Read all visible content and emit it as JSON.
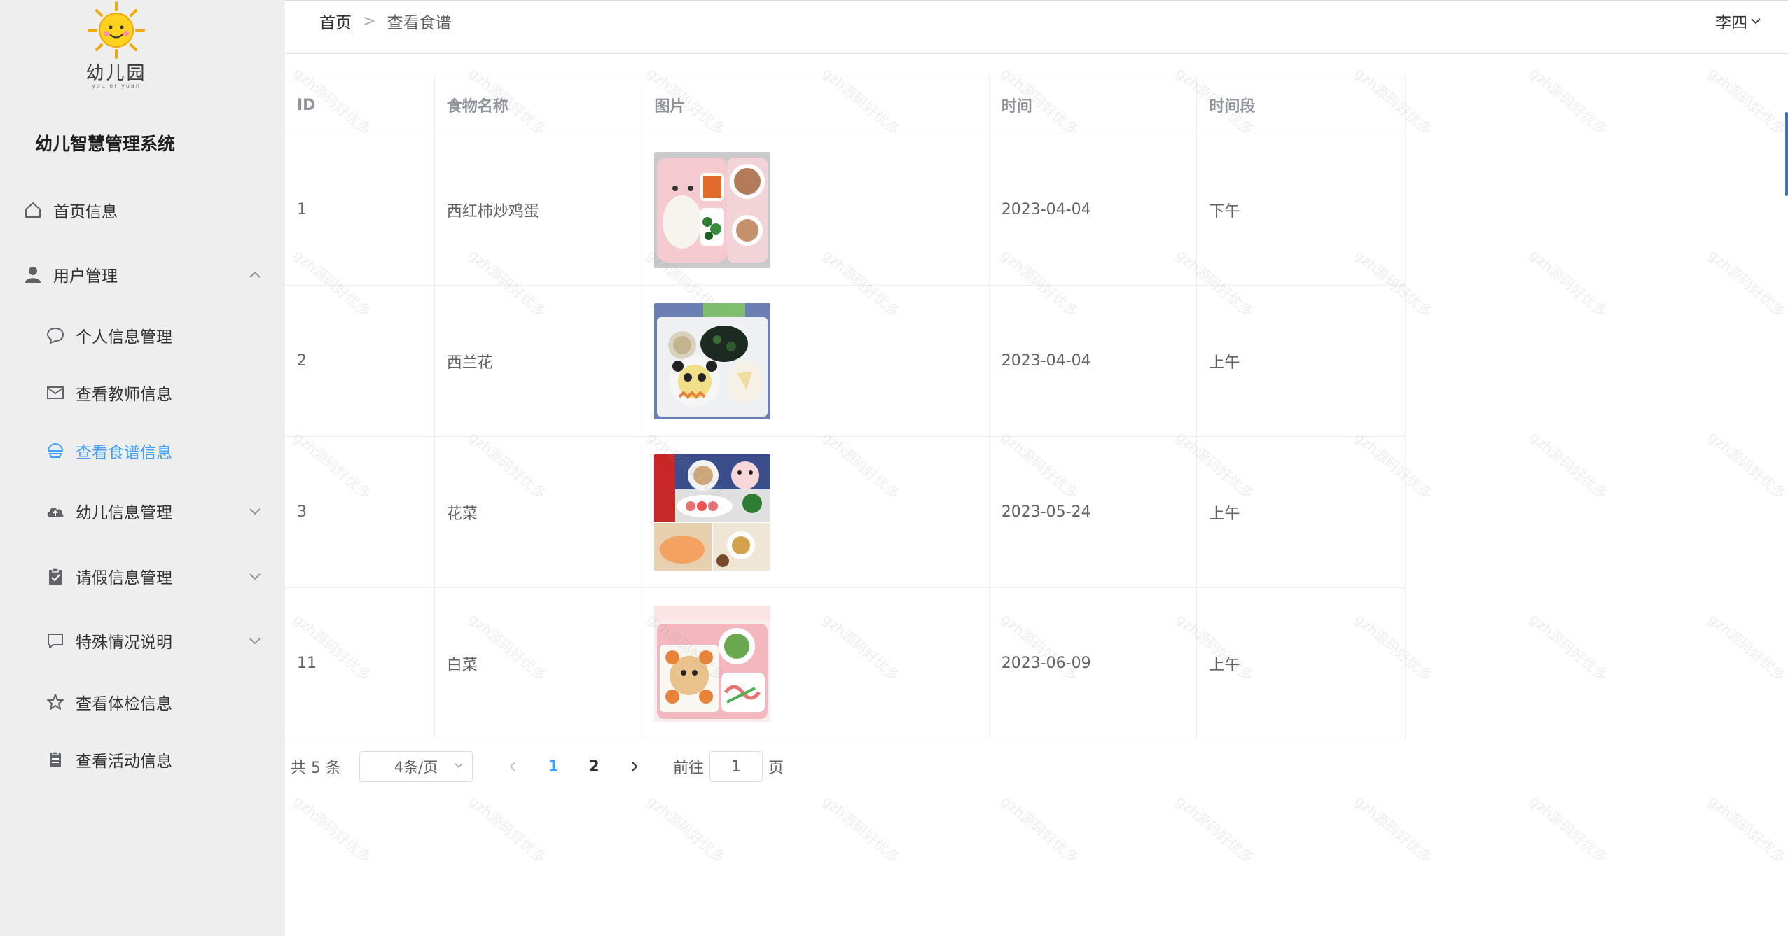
{
  "sidebar": {
    "logo_text": "幼儿园",
    "logo_sub": "you er yuan",
    "title": "幼儿智慧管理系统",
    "items": [
      {
        "label": "首页信息",
        "icon": "home-icon",
        "expanded": null,
        "active": false
      },
      {
        "label": "用户管理",
        "icon": "user-icon",
        "expanded": true,
        "active": false
      },
      {
        "label": "个人信息管理",
        "icon": "chat-bubble-icon",
        "expanded": null,
        "active": false
      },
      {
        "label": "查看教师信息",
        "icon": "mail-icon",
        "expanded": null,
        "active": false
      },
      {
        "label": "查看食谱信息",
        "icon": "bowl-icon",
        "expanded": null,
        "active": true
      },
      {
        "label": "幼儿信息管理",
        "icon": "cloud-upload-icon",
        "expanded": false,
        "active": false
      },
      {
        "label": "请假信息管理",
        "icon": "clipboard-check-icon",
        "expanded": false,
        "active": false
      },
      {
        "label": "特殊情况说明",
        "icon": "chat-square-icon",
        "expanded": false,
        "active": false
      },
      {
        "label": "查看体检信息",
        "icon": "star-icon",
        "expanded": null,
        "active": false
      },
      {
        "label": "查看活动信息",
        "icon": "document-icon",
        "expanded": null,
        "active": false
      }
    ]
  },
  "header": {
    "breadcrumb": [
      "首页",
      "查看食谱"
    ],
    "user_name": "李四"
  },
  "table": {
    "columns": [
      "ID",
      "食物名称",
      "图片",
      "时间",
      "时间段"
    ],
    "rows": [
      {
        "id": "1",
        "name": "西红柿炒鸡蛋",
        "image": "meal-photo-pink-tray",
        "date": "2023-04-04",
        "period": "下午"
      },
      {
        "id": "2",
        "name": "西兰花",
        "image": "meal-photo-panda-plate",
        "date": "2023-04-04",
        "period": "上午"
      },
      {
        "id": "3",
        "name": "花菜",
        "image": "meal-photo-collage",
        "date": "2023-05-24",
        "period": "上午"
      },
      {
        "id": "11",
        "name": "白菜",
        "image": "meal-photo-bear-plate",
        "date": "2023-06-09",
        "period": "上午"
      }
    ]
  },
  "pagination": {
    "total_text": "共 5 条",
    "page_size": "4条/页",
    "pages": [
      "1",
      "2"
    ],
    "current_page": "1",
    "goto_label": "前往",
    "goto_value": "1",
    "goto_suffix": "页"
  },
  "watermark": "gzh源码好优多",
  "colors": {
    "accent": "#409eff",
    "sidebar_bg": "#eeeeef"
  }
}
